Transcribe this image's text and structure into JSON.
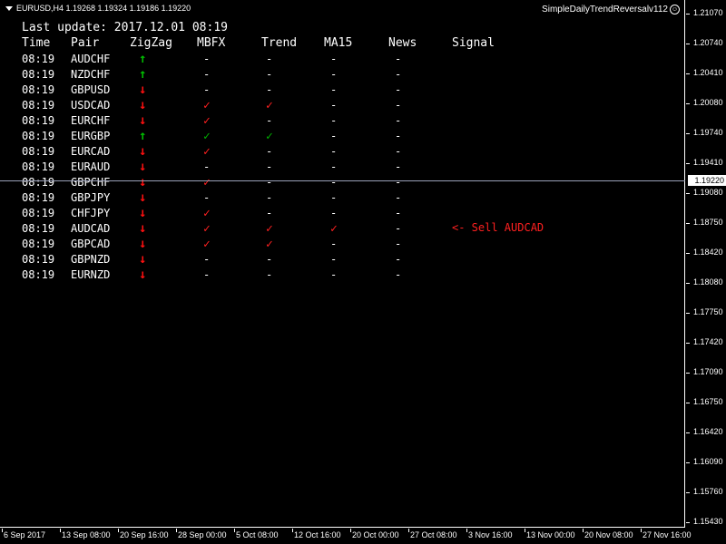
{
  "window": {
    "symbol_info": "EURUSD,H4  1.19268 1.19324 1.19186 1.19220",
    "ea_name": "SimpleDailyTrendReversalv112",
    "ea_icon": "smiley-icon"
  },
  "panel": {
    "last_update": "Last update: 2017.12.01 08:19",
    "headers": {
      "time": "Time",
      "pair": "Pair",
      "zigzag": "ZigZag",
      "mbfx": "MBFX",
      "trend": "Trend",
      "ma15": "MA15",
      "news": "News",
      "signal": "Signal"
    },
    "rows": [
      {
        "time": "08:19",
        "pair": "AUDCHF",
        "zigzag": "up",
        "mbfx": "-",
        "trend": "-",
        "ma15": "-",
        "news": "-"
      },
      {
        "time": "08:19",
        "pair": "NZDCHF",
        "zigzag": "up",
        "mbfx": "-",
        "trend": "-",
        "ma15": "-",
        "news": "-"
      },
      {
        "time": "08:19",
        "pair": "GBPUSD",
        "zigzag": "down",
        "mbfx": "-",
        "trend": "-",
        "ma15": "-",
        "news": "-"
      },
      {
        "time": "08:19",
        "pair": "USDCAD",
        "zigzag": "down",
        "mbfx": "check-red",
        "trend": "check-red",
        "ma15": "-",
        "news": "-"
      },
      {
        "time": "08:19",
        "pair": "EURCHF",
        "zigzag": "down",
        "mbfx": "check-red",
        "trend": "-",
        "ma15": "-",
        "news": "-"
      },
      {
        "time": "08:19",
        "pair": "EURGBP",
        "zigzag": "up",
        "mbfx": "check-green",
        "trend": "check-green",
        "ma15": "-",
        "news": "-"
      },
      {
        "time": "08:19",
        "pair": "EURCAD",
        "zigzag": "down",
        "mbfx": "check-red",
        "trend": "-",
        "ma15": "-",
        "news": "-"
      },
      {
        "time": "08:19",
        "pair": "EURAUD",
        "zigzag": "down",
        "mbfx": "-",
        "trend": "-",
        "ma15": "-",
        "news": "-"
      },
      {
        "time": "08:19",
        "pair": "GBPCHF",
        "zigzag": "down",
        "mbfx": "check-red",
        "trend": "-",
        "ma15": "-",
        "news": "-"
      },
      {
        "time": "08:19",
        "pair": "GBPJPY",
        "zigzag": "down",
        "mbfx": "-",
        "trend": "-",
        "ma15": "-",
        "news": "-"
      },
      {
        "time": "08:19",
        "pair": "CHFJPY",
        "zigzag": "down",
        "mbfx": "check-red",
        "trend": "-",
        "ma15": "-",
        "news": "-"
      },
      {
        "time": "08:19",
        "pair": "AUDCAD",
        "zigzag": "down",
        "mbfx": "check-red",
        "trend": "check-red",
        "ma15": "check-red",
        "news": "-"
      },
      {
        "time": "08:19",
        "pair": "GBPCAD",
        "zigzag": "down",
        "mbfx": "check-red",
        "trend": "check-red",
        "ma15": "-",
        "news": "-"
      },
      {
        "time": "08:19",
        "pair": "GBPNZD",
        "zigzag": "down",
        "mbfx": "-",
        "trend": "-",
        "ma15": "-",
        "news": "-"
      },
      {
        "time": "08:19",
        "pair": "EURNZD",
        "zigzag": "down",
        "mbfx": "-",
        "trend": "-",
        "ma15": "-",
        "news": "-"
      }
    ],
    "signal_text": "<- Sell  AUDCAD"
  },
  "price_axis": {
    "labels": [
      "1.21070",
      "1.20740",
      "1.20410",
      "1.20080",
      "1.19740",
      "1.19410",
      "1.19080",
      "1.18750",
      "1.18420",
      "1.18080",
      "1.17750",
      "1.17420",
      "1.17090",
      "1.16750",
      "1.16420",
      "1.16090",
      "1.15760",
      "1.15430"
    ],
    "current_price": "1.19220"
  },
  "time_axis": {
    "labels": [
      "6 Sep 2017",
      "13 Sep 08:00",
      "20 Sep 16:00",
      "28 Sep 00:00",
      "5 Oct 08:00",
      "12 Oct 16:00",
      "20 Oct 00:00",
      "27 Oct 08:00",
      "3 Nov 16:00",
      "13 Nov 00:00",
      "20 Nov 08:00",
      "27 Nov 16:00"
    ]
  },
  "colors": {
    "up": "#00c000",
    "down": "#ff1010",
    "check_red": "#ff2020",
    "check_green": "#00b000",
    "crosshair": "#9aa0b8"
  }
}
